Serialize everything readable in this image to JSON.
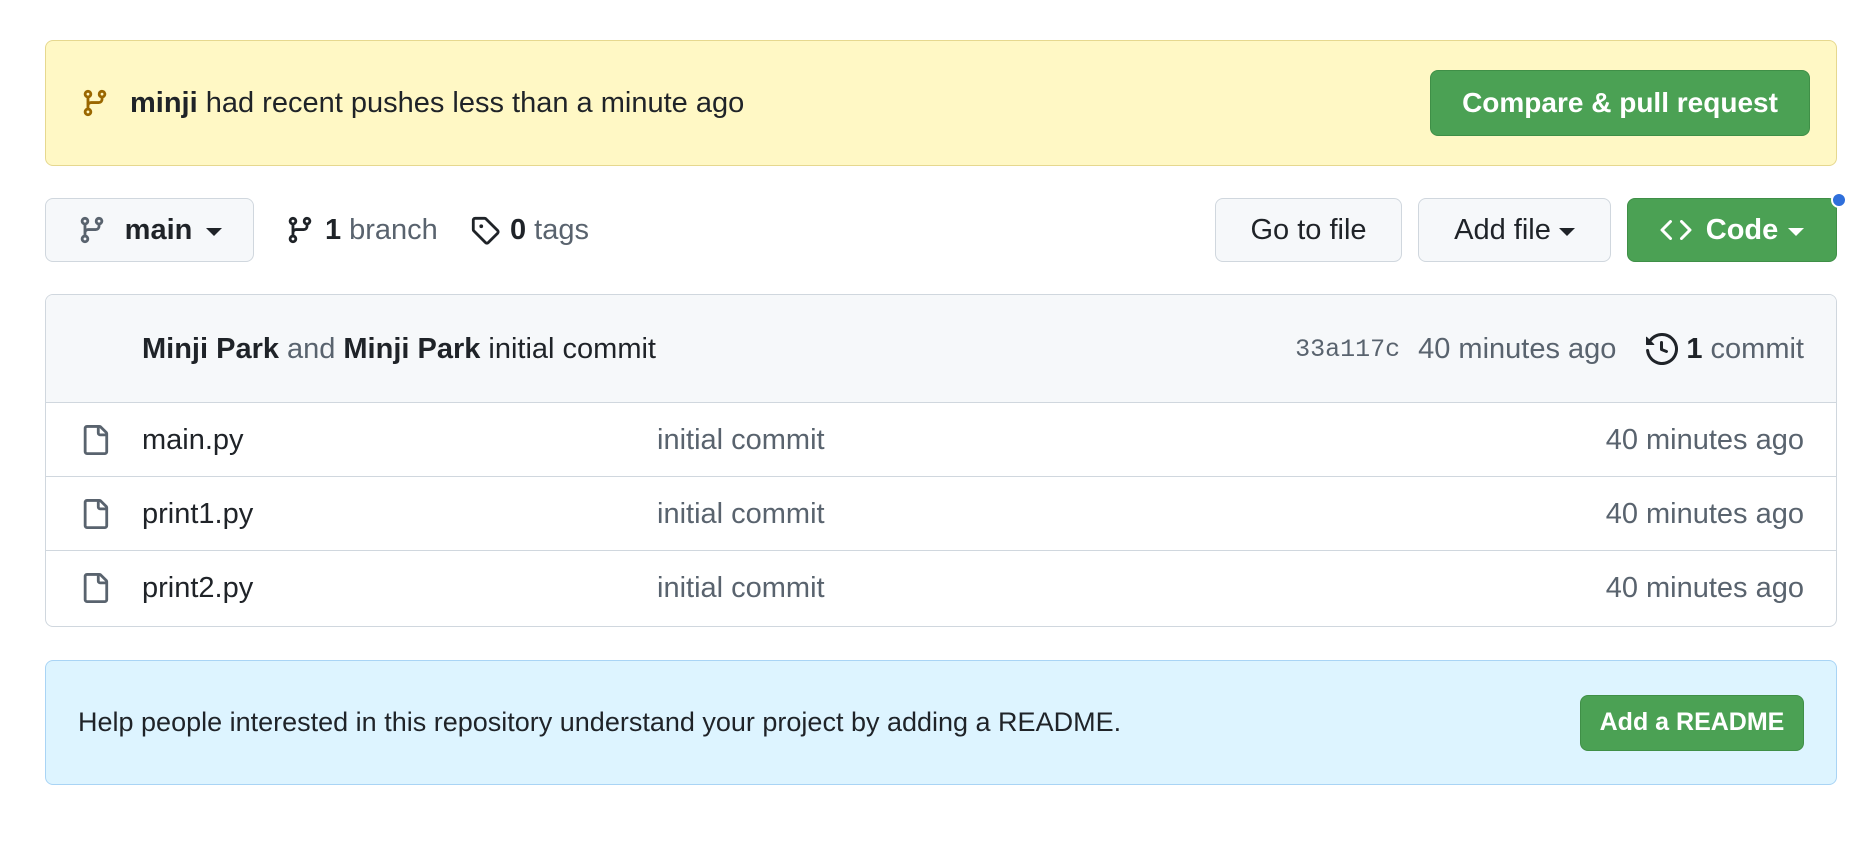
{
  "push_banner": {
    "user": "minji",
    "message": "had recent pushes less than a minute ago",
    "button_label": "Compare & pull request"
  },
  "toolbar": {
    "branch": "main",
    "branch_count": "1",
    "branch_label": "branch",
    "tag_count": "0",
    "tag_label": "tags",
    "goto_label": "Go to file",
    "addfile_label": "Add file",
    "code_label": "Code"
  },
  "latest_commit": {
    "author1": "Minji Park",
    "conjunction": "and",
    "author2": "Minji Park",
    "message": "initial commit",
    "sha": "33a117c",
    "time": "40 minutes ago",
    "commit_count": "1",
    "commit_label": "commit"
  },
  "files": [
    {
      "name": "main.py",
      "message": "initial commit",
      "time": "40 minutes ago"
    },
    {
      "name": "print1.py",
      "message": "initial commit",
      "time": "40 minutes ago"
    },
    {
      "name": "print2.py",
      "message": "initial commit",
      "time": "40 minutes ago"
    }
  ],
  "readme_banner": {
    "text": "Help people interested in this repository understand your project by adding a README.",
    "button_label": "Add a README"
  },
  "colors": {
    "green": "#4ba154",
    "push_bg": "#fff8c5",
    "readme_bg": "#ddf4ff",
    "notify_dot": "#2f6fdb"
  }
}
